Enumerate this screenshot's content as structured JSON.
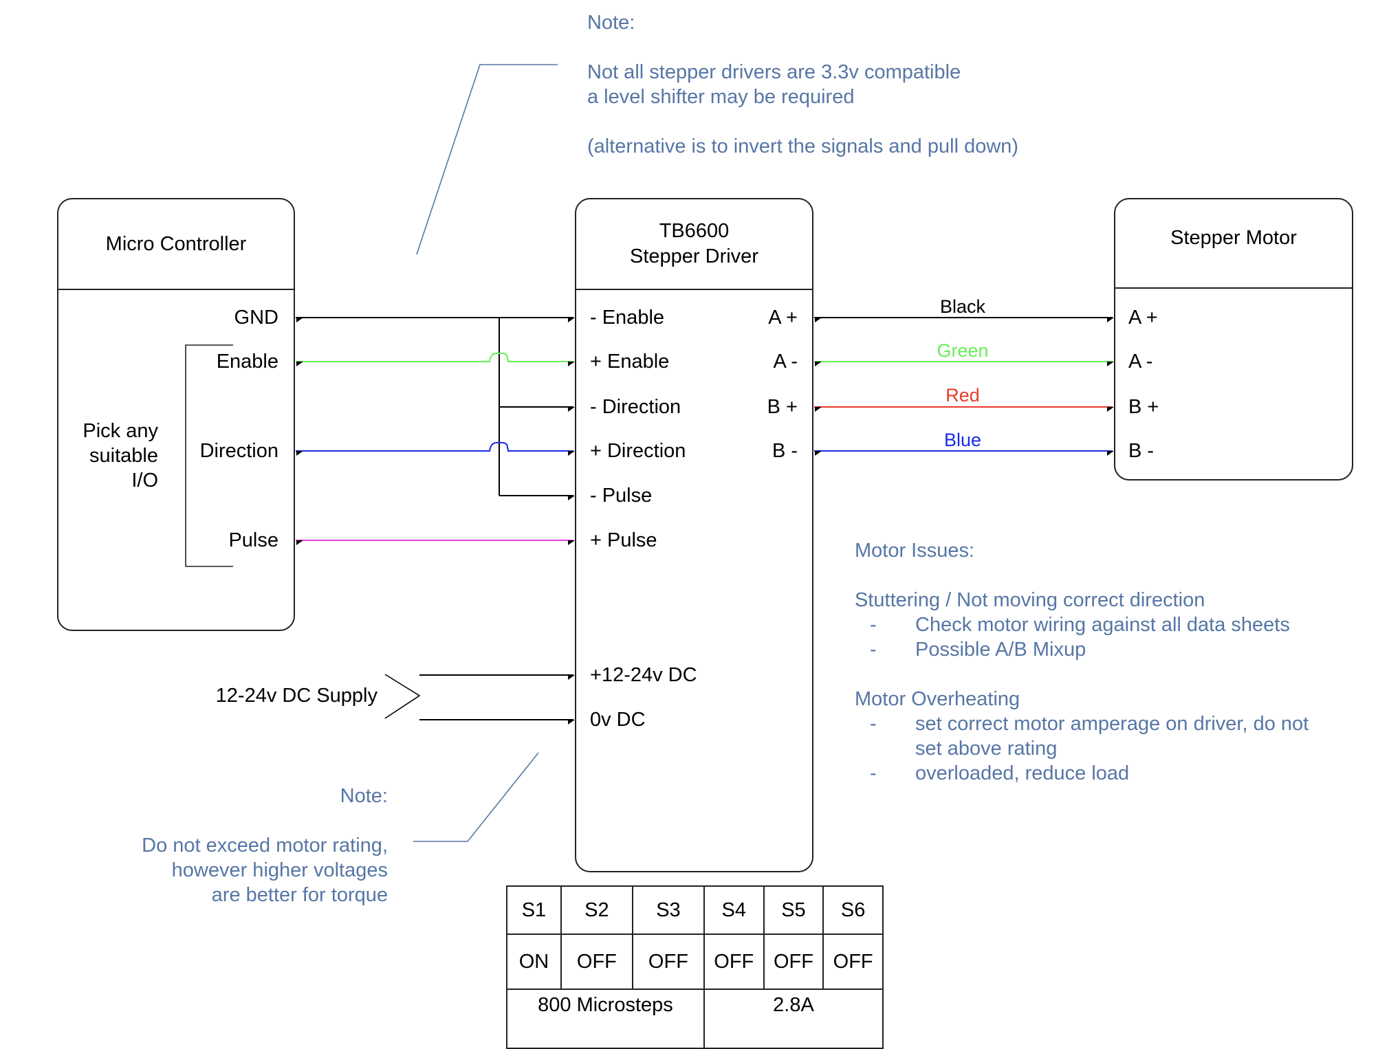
{
  "top_note": {
    "title": "Note:",
    "lines": [
      "Not all stepper drivers are 3.3v compatible",
      "a level shifter may be required",
      "(alternative is to invert the signals and pull down)"
    ]
  },
  "micro_controller": {
    "title": "Micro Controller",
    "pins": [
      "GND",
      "Enable",
      "Direction",
      "Pulse"
    ],
    "io_note": [
      "Pick any",
      "suitable",
      "I/O"
    ]
  },
  "driver": {
    "title_line1": "TB6600",
    "title_line2": "Stepper Driver",
    "left_pins": [
      "- Enable",
      "+ Enable",
      "- Direction",
      "+ Direction",
      "- Pulse",
      "+ Pulse",
      "+12-24v DC",
      "0v DC"
    ],
    "right_pins": [
      "A +",
      "A -",
      "B +",
      "B -"
    ]
  },
  "motor": {
    "title": "Stepper Motor",
    "pins": [
      "A +",
      "A -",
      "B +",
      "B -"
    ]
  },
  "motor_wires": [
    {
      "label": "Black",
      "color": "#000000"
    },
    {
      "label": "Green",
      "color": "#66ee55"
    },
    {
      "label": "Red",
      "color": "#e83a2a"
    },
    {
      "label": "Blue",
      "color": "#1a2ae8"
    }
  ],
  "signal_wire_colors": {
    "gnd": "#000000",
    "enable": "#66ee55",
    "direction": "#1a2ae8",
    "pulse": "#e040e0"
  },
  "supply": {
    "label": "12-24v DC Supply"
  },
  "bottom_note": {
    "title": "Note:",
    "lines": [
      "Do not exceed motor rating,",
      "however higher voltages",
      "are better for torque"
    ]
  },
  "motor_issues": {
    "title": "Motor Issues:",
    "sections": [
      {
        "heading": "Stuttering / Not moving correct direction",
        "items": [
          "Check motor wiring against all data sheets",
          "Possible A/B Mixup"
        ]
      },
      {
        "heading": "Motor Overheating",
        "items": [
          "set correct motor amperage on driver, do not",
          "set above rating",
          "overloaded, reduce load"
        ]
      }
    ],
    "bullet": "-"
  },
  "switch_table": {
    "headers": [
      "S1",
      "S2",
      "S3",
      "S4",
      "S5",
      "S6"
    ],
    "states": [
      "ON",
      "OFF",
      "OFF",
      "OFF",
      "OFF",
      "OFF"
    ],
    "summary": [
      "800 Microsteps",
      "2.8A"
    ]
  },
  "note_color": "#5676a5"
}
